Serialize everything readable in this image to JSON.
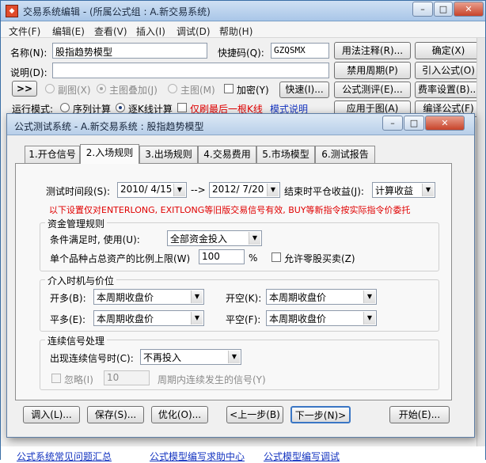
{
  "window": {
    "title": "交易系统编辑 - (所属公式组 : A.新交易系统)",
    "app_icon": "app-icon"
  },
  "menu": [
    "文件(F)",
    "编辑(E)",
    "查看(V)",
    "插入(I)",
    "调试(D)",
    "帮助(H)"
  ],
  "form": {
    "name_label": "名称(N):",
    "name_value": "股指趋势模型",
    "shortcut_label": "快捷码(Q):",
    "shortcut_value": "GZQSMX",
    "desc_label": "说明(D):",
    "desc_value": "",
    "expand_button": ">>",
    "view_options": {
      "sub_chart": "副图(X)",
      "main_overlay": "主图叠加(J)",
      "main_chart": "主图(M)",
      "selected": "main_overlay"
    },
    "encrypt_label": "加密(Y)",
    "quick_button": "快速(I)...",
    "run_mode_label": "运行模式:",
    "run_mode_sequential": "序列计算",
    "run_mode_line_by_line": "逐K线计算",
    "run_mode_selected": "line_by_line",
    "only_last_bar_label": "仅刷最后一根K线",
    "mode_help_link": "模式说明"
  },
  "right_buttons": {
    "usage_notes": "用法注释(R)...",
    "ok": "确定(X)",
    "disable_period": "禁用周期(P)",
    "import_formula": "引入公式(O)",
    "formula_test": "公式测评(E)...",
    "fee_settings": "费率设置(B)...",
    "apply_to_chart": "应用于图(A)",
    "compile_formula": "编译公式(F)"
  },
  "dialog": {
    "title": "公式测试系统 - A.新交易系统 : 股指趋势模型",
    "tabs": [
      "1.开仓信号",
      "2.入场规则",
      "3.出场规则",
      "4.交易费用",
      "5.市场模型",
      "6.测试报告"
    ],
    "active_tab": 1,
    "test_period_label": "测试时间段(S):",
    "start_date": "2010/ 4/15",
    "arrow": "-->",
    "end_date": "2012/ 7/20",
    "close_profit_label": "结束时平仓收益(J):",
    "close_profit_value": "计算收益",
    "notice": "以下设置仅对ENTERLONG, EXITLONG等旧版交易信号有效, BUY等新指令按实际指令价委托",
    "capital_group": {
      "title": "资金管理规则",
      "condition_label": "条件满足时, 使用(U):",
      "condition_value": "全部资金投入",
      "max_ratio_label": "单个品种占总资产的比例上限(W)",
      "max_ratio_value": "100",
      "percent": "%",
      "allow_odd_label": "允许零股买卖(Z)"
    },
    "timing_group": {
      "title": "介入时机与价位",
      "open_long_label": "开多(B):",
      "open_long_value": "本周期收盘价",
      "open_short_label": "开空(K):",
      "open_short_value": "本周期收盘价",
      "close_long_label": "平多(E):",
      "close_long_value": "本周期收盘价",
      "close_short_label": "平空(F):",
      "close_short_value": "本周期收盘价"
    },
    "signal_group": {
      "title": "连续信号处理",
      "continuous_label": "出现连续信号时(C):",
      "continuous_value": "不再投入",
      "ignore_label": "忽略(I)",
      "ignore_value": "10",
      "ignore_suffix": "周期内连续发生的信号(Y)"
    },
    "buttons": {
      "import": "调入(L)...",
      "save": "保存(S)...",
      "optimize": "优化(O)...",
      "prev": "<上一步(B)",
      "next": "下一步(N)>",
      "start": "开始(E)..."
    }
  },
  "statusbar": {
    "links": [
      "公式系统常见问题汇总",
      "公式模型编写求助中心",
      "公式模型编写调试"
    ]
  }
}
